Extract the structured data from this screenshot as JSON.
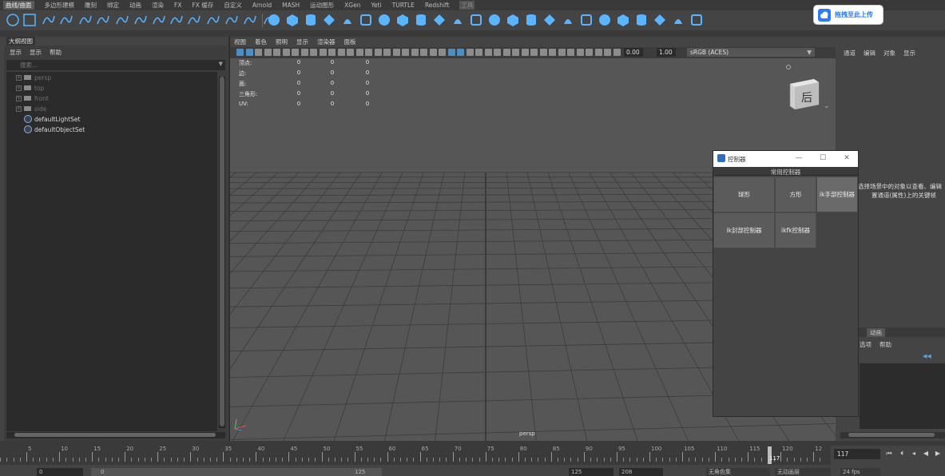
{
  "shelf": {
    "tabs": [
      "曲线/曲面",
      "多边形建模",
      "雕刻",
      "绑定",
      "动画",
      "渲染",
      "FX",
      "FX 缓存",
      "自定义",
      "Arnold",
      "MASH",
      "运动图形",
      "XGen",
      "Yeti",
      "TURTLE",
      "Redshift",
      "工具"
    ],
    "active_index": 0,
    "disabled_index": 16,
    "accent": "#5ab4ff"
  },
  "upload_button": {
    "label": "拖拽至此上传",
    "color": "#2e7bf6"
  },
  "outliner": {
    "title": "大纲视图",
    "menu": [
      "显示",
      "显示",
      "帮助"
    ],
    "search_placeholder": "搜索...",
    "items": [
      {
        "label": "persp",
        "type": "camera",
        "dim": true
      },
      {
        "label": "top",
        "type": "camera",
        "dim": true
      },
      {
        "label": "front",
        "type": "camera",
        "dim": true
      },
      {
        "label": "side",
        "type": "camera",
        "dim": true
      },
      {
        "label": "defaultLightSet",
        "type": "set",
        "dim": false
      },
      {
        "label": "defaultObjectSet",
        "type": "set",
        "dim": false
      }
    ]
  },
  "viewport": {
    "menu": [
      "视图",
      "着色",
      "照明",
      "显示",
      "渲染器",
      "面板"
    ],
    "exposure": "0.00",
    "gamma": "1.00",
    "color_space": "sRGB (ACES)",
    "camera_label": "persp",
    "hud": [
      {
        "label": "顶点:",
        "values": [
          "0",
          "0",
          "0"
        ]
      },
      {
        "label": "边:",
        "values": [
          "0",
          "0",
          "0"
        ]
      },
      {
        "label": "面:",
        "values": [
          "0",
          "0",
          "0"
        ]
      },
      {
        "label": "三角形:",
        "values": [
          "0",
          "0",
          "0"
        ]
      },
      {
        "label": "UV:",
        "values": [
          "0",
          "0",
          "0"
        ]
      }
    ],
    "viewcube_face": "后"
  },
  "right_panel": {
    "menu": [
      "通道",
      "编辑",
      "对象",
      "显示"
    ],
    "hint_line1": "选择场景中的对象以查看、编辑",
    "hint_line2": "置通道(属性)上的关键帧",
    "layers_tab": "动画",
    "layer_menu": [
      "选项",
      "帮助"
    ]
  },
  "dialog": {
    "title": "控制器",
    "group_label": "常用控制器",
    "buttons": [
      "球形",
      "方形",
      "ik手部控制器",
      "ik封部控制器",
      "ikfk控制器"
    ],
    "minimize": "—",
    "maximize": "☐",
    "close": "✕"
  },
  "timeline": {
    "labels": [
      "5",
      "10",
      "15",
      "20",
      "25",
      "30",
      "35",
      "40",
      "45",
      "50",
      "55",
      "60",
      "65",
      "70",
      "75",
      "80",
      "85",
      "90",
      "95",
      "100",
      "105",
      "110",
      "115",
      "120",
      "12"
    ],
    "current": "117",
    "current_field": "117"
  },
  "range": {
    "start": "0",
    "inner_start": "0",
    "inner_end": "125",
    "end": "125",
    "end2": "208",
    "character_set": "无角色集",
    "anim_layer": "无动画层",
    "fps": "24 fps"
  }
}
